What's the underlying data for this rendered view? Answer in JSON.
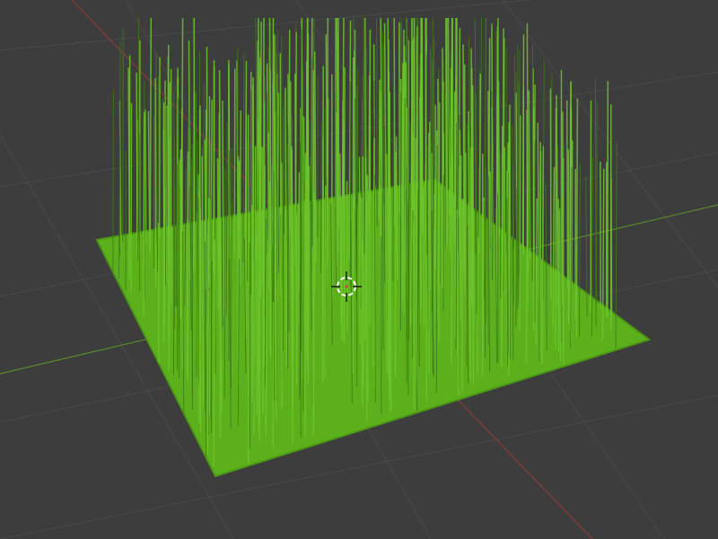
{
  "viewport": {
    "background_color": "#3d3d3d",
    "grid_color": "#4a4a4a",
    "x_axis_color": "#8b3a3a",
    "y_axis_color": "#5a8a2a"
  },
  "objects": {
    "ground_plane": {
      "color": "#5cb01c",
      "edge_color": "#4a9a14"
    },
    "grass_strands": {
      "color": "#6cc42a",
      "dark_color": "#3f7a16"
    }
  },
  "cursor_3d": {
    "icon": "3d-cursor-icon",
    "ring_color": "#ffffff",
    "accent_color": "#d94040"
  }
}
